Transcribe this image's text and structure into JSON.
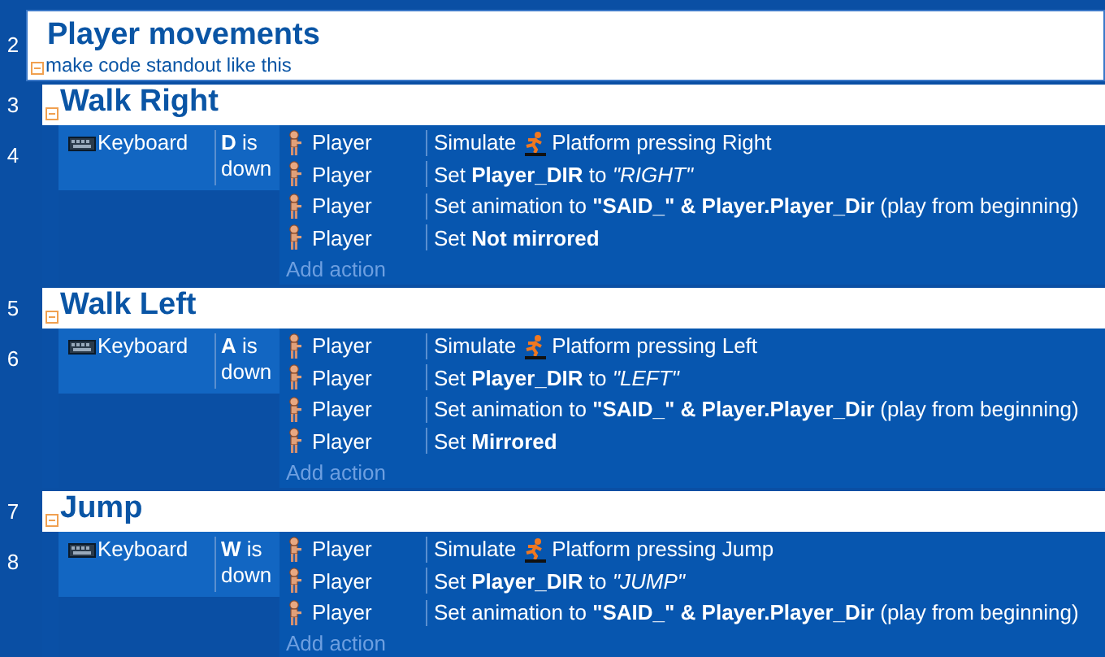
{
  "comment": {
    "line": "2",
    "title": "Player movements",
    "text": "make code standout like this",
    "expanded": true
  },
  "groups": [
    {
      "line": "3",
      "title": "Walk Right",
      "expanded": true,
      "event": {
        "line": "4",
        "condition": {
          "object": "Keyboard",
          "text": "**D** is down"
        },
        "actions": [
          {
            "object": "Player",
            "kind": "simulate",
            "text": "Simulate",
            "behavior": "Platform pressing Right"
          },
          {
            "object": "Player",
            "kind": "plain",
            "text": "Set **Player_DIR** to *\"RIGHT\"*"
          },
          {
            "object": "Player",
            "kind": "plain",
            "text": "Set animation to **\"SAID_\" & Player.Player_Dir** (play from beginning)"
          },
          {
            "object": "Player",
            "kind": "plain",
            "text": "Set **Not mirrored**"
          }
        ],
        "add_action": "Add action"
      }
    },
    {
      "line": "5",
      "title": "Walk Left",
      "expanded": true,
      "event": {
        "line": "6",
        "condition": {
          "object": "Keyboard",
          "text": "**A** is down"
        },
        "actions": [
          {
            "object": "Player",
            "kind": "simulate",
            "text": "Simulate",
            "behavior": "Platform pressing Left"
          },
          {
            "object": "Player",
            "kind": "plain",
            "text": "Set **Player_DIR** to *\"LEFT\"*"
          },
          {
            "object": "Player",
            "kind": "plain",
            "text": "Set animation to **\"SAID_\" & Player.Player_Dir** (play from beginning)"
          },
          {
            "object": "Player",
            "kind": "plain",
            "text": "Set **Mirrored**"
          }
        ],
        "add_action": "Add action"
      }
    },
    {
      "line": "7",
      "title": "Jump",
      "expanded": true,
      "event": {
        "line": "8",
        "condition": {
          "object": "Keyboard",
          "text": "**W** is down"
        },
        "actions": [
          {
            "object": "Player",
            "kind": "simulate",
            "text": "Simulate",
            "behavior": "Platform pressing Jump"
          },
          {
            "object": "Player",
            "kind": "plain",
            "text": "Set **Player_DIR** to *\"JUMP\"*"
          },
          {
            "object": "Player",
            "kind": "plain",
            "text": "Set animation to **\"SAID_\" & Player.Player_Dir** (play from beginning)"
          }
        ],
        "add_action": "Add action"
      }
    }
  ]
}
